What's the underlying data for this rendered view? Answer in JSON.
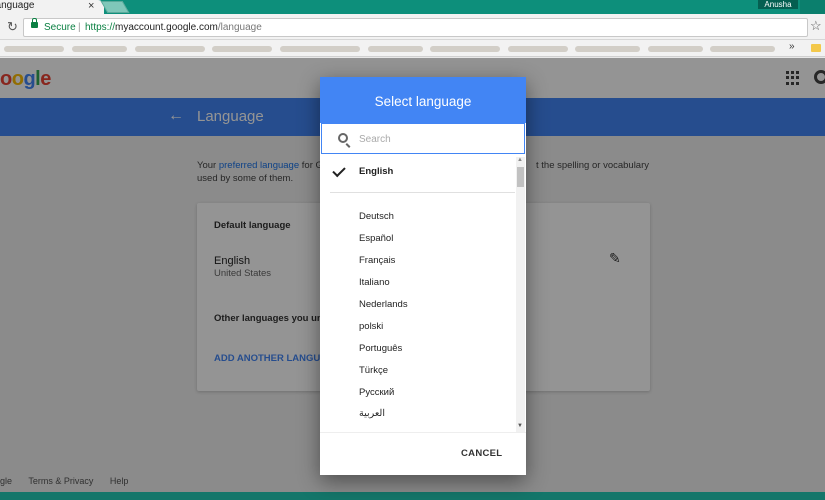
{
  "browser": {
    "tab_title": "Language",
    "tab_close": "×",
    "profile_name": "Anusha",
    "secure_label": "Secure",
    "url_proto": "https://",
    "url_host": "myaccount.google.com",
    "url_path": "/language",
    "bookmarks_more": "»"
  },
  "page": {
    "logo": "Google",
    "header_title": "Language",
    "intro_prefix": "Your ",
    "intro_link": "preferred language",
    "intro_suffix": " for G",
    "intro_line2": "used by some of them.",
    "intro_right": "t the spelling or vocabulary",
    "card_default_heading": "Default language",
    "card_language": "English",
    "card_region": "United States",
    "card_other_heading": "Other languages you und",
    "card_add_link": "ADD ANOTHER LANGUAG",
    "footer_links": [
      "gle",
      "Terms & Privacy",
      "Help"
    ]
  },
  "dialog": {
    "title": "Select language",
    "search_placeholder": "Search",
    "selected_language": "English",
    "languages": [
      "Deutsch",
      "Español",
      "Français",
      "Italiano",
      "Nederlands",
      "polski",
      "Português",
      "Türkçe",
      "Русский",
      "العربية"
    ],
    "cancel_label": "CANCEL"
  },
  "colors": {
    "accent_blue": "#4285f4",
    "secure_green": "#0b8043",
    "tabbar_teal": "#0d8f7b"
  },
  "icons": [
    "close-icon",
    "reload-icon",
    "lock-icon",
    "star-icon",
    "apps-icon",
    "back-arrow-icon",
    "edit-icon",
    "search-icon",
    "check-icon"
  ]
}
